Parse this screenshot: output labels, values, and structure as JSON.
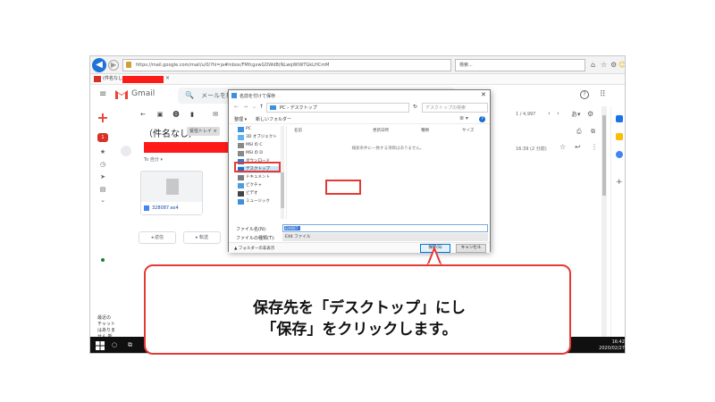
{
  "browser": {
    "url": "https://mail.google.com/mail/u/0/?hl=ja#inbox/FMfcgxwGDWdB(NLwqWtWTGkLHCmM",
    "search_placeholder": "検索...",
    "tab_label": "(件名なし)"
  },
  "gmail": {
    "wordmark": "Gmail",
    "search_placeholder": "メールを検",
    "inbox_badge": "1",
    "message_count": "1 / 4,997",
    "subject": "（件名なし）",
    "subject_label": "受信トレイ ×",
    "to_line": "To 自分 ▾",
    "time": "16:39 (2 分前)",
    "attachment_name": "328087.ex4",
    "reply_button": "返信",
    "forward_button": "転送",
    "chat_text": "最近のチャットはありません 新しいチャットを開始しませんか"
  },
  "dialog": {
    "title": "名前を付けて保存",
    "path": "PC › デスクトップ",
    "search_placeholder": "デスクトップの検索",
    "organize": "整理 ▾",
    "new_folder": "新しいフォルダー",
    "tree": [
      {
        "label": "PC",
        "icon": "pc-icon"
      },
      {
        "label": "3D オブジェクト",
        "icon": "3d-objects-icon"
      },
      {
        "label": "MSI の C",
        "icon": "drive-icon"
      },
      {
        "label": "MSI の D",
        "icon": "drive-icon"
      },
      {
        "label": "ダウンロード",
        "icon": "download-icon"
      },
      {
        "label": "デスクトップ",
        "icon": "desktop-folder-icon"
      },
      {
        "label": "ドキュメント",
        "icon": "documents-icon"
      },
      {
        "label": "ピクチャ",
        "icon": "pictures-icon"
      },
      {
        "label": "ビデオ",
        "icon": "videos-icon"
      },
      {
        "label": "ミュージック",
        "icon": "music-icon"
      }
    ],
    "columns": [
      "名前",
      "更新日時",
      "種類",
      "サイズ"
    ],
    "empty_message": "検索条件に一致する項目はありません。",
    "filename_label": "ファイル名(N):",
    "filename_value": "328087",
    "filetype_label": "ファイルの種類(T):",
    "filetype_value": "EX4 ファイル",
    "hide_folders": "フォルダーの非表示",
    "save_button": "保存(S)",
    "cancel_button": "キャンセル"
  },
  "taskbar": {
    "time": "16:42",
    "date": "2020/02/27"
  },
  "callout": {
    "line1": "保存先を「デスクトップ」にし",
    "line2": "「保存」をクリックします。"
  },
  "colors": {
    "highlight": "#e53935",
    "accent": "#0078d7",
    "redaction": "#ff1a1a"
  }
}
